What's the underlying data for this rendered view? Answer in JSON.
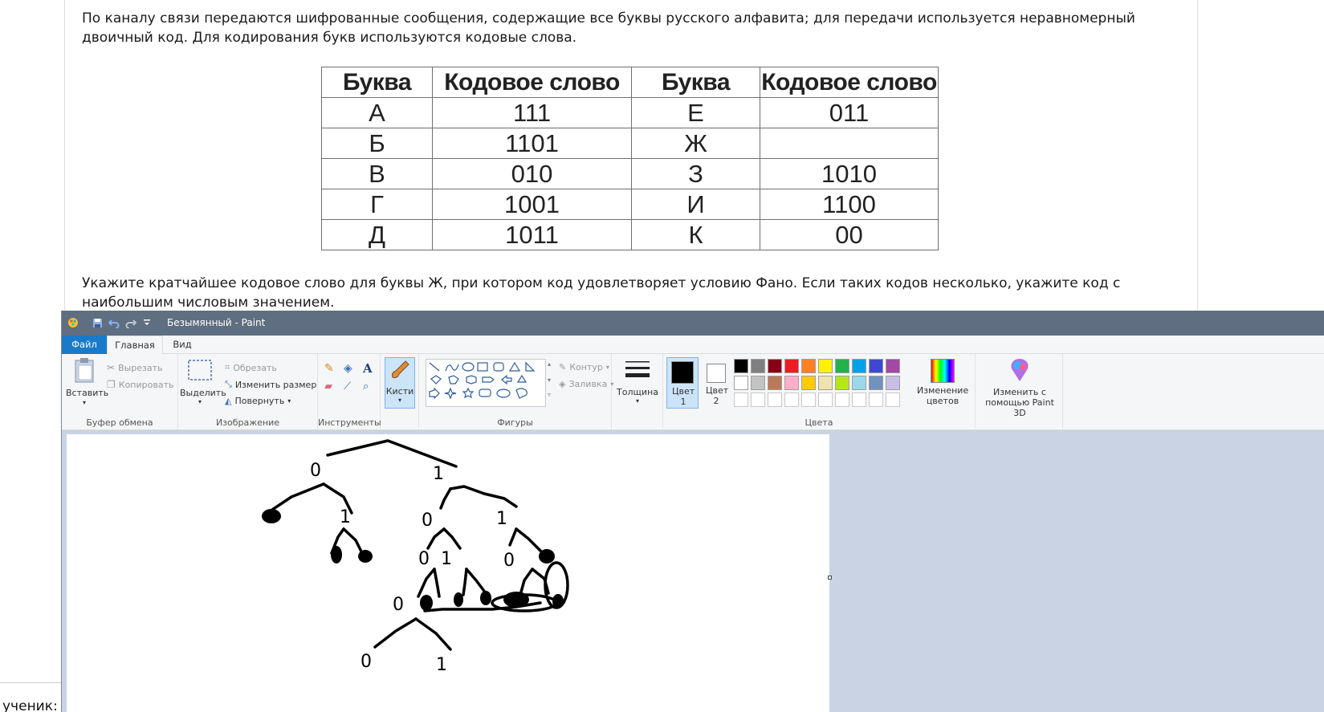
{
  "web": {
    "paragraph_1": "По каналу связи передаются шифрованные сообщения, содержащие все буквы русского алфавита; для передачи используется неравномерный двоичный код. Для кодирования букв используются кодовые слова.",
    "paragraph_2": "Укажите кратчайшее кодовое слово для буквы Ж, при котором код удовлетворяет условию Фано. Если таких кодов несколько, укажите код с наибольшим числовым значением.",
    "table": {
      "headers": [
        "Буква",
        "Кодовое слово",
        "Буква",
        "Кодовое слово"
      ],
      "rows": [
        [
          "А",
          "111",
          "Е",
          "011"
        ],
        [
          "Б",
          "1101",
          "Ж",
          ""
        ],
        [
          "В",
          "010",
          "З",
          "1010"
        ],
        [
          "Г",
          "1001",
          "И",
          "1100"
        ],
        [
          "Д",
          "1011",
          "К",
          "00"
        ]
      ]
    },
    "student_label": "ученик:"
  },
  "paint": {
    "title": "Безымянный - Paint",
    "tabs": [
      "Файл",
      "Главная",
      "Вид"
    ],
    "clipboard": {
      "paste": "Вставить",
      "cut": "Вырезать",
      "copy": "Копировать",
      "label": "Буфер обмена"
    },
    "image": {
      "select": "Выделить",
      "crop": "Обрезать",
      "resize": "Изменить размер",
      "rotate": "Повернуть",
      "label": "Изображение"
    },
    "tools": {
      "label": "Инструменты"
    },
    "brushes": {
      "label": "Кисти"
    },
    "shapes": {
      "outline": "Контур",
      "fill": "Заливка",
      "label": "Фигуры"
    },
    "size": {
      "label": "Толщина"
    },
    "colors": {
      "color1": "Цвет 1",
      "color2": "Цвет 2",
      "edit": "Изменение цветов",
      "paint3d": "Изменить с помощью Paint 3D",
      "label": "Цвета",
      "palette_row1": [
        "#000000",
        "#7f7f7f",
        "#880015",
        "#ed1c24",
        "#ff7f27",
        "#fff200",
        "#22b14c",
        "#00a2e8",
        "#3f48cc",
        "#a349a4"
      ],
      "palette_row2": [
        "#ffffff",
        "#c3c3c3",
        "#b97a57",
        "#ffaec9",
        "#ffc90e",
        "#efe4b0",
        "#b5e61d",
        "#99d9ea",
        "#7092be",
        "#c8bfe7"
      ],
      "palette_row3": [
        "#ffffff",
        "#ffffff",
        "#ffffff",
        "#ffffff",
        "#ffffff",
        "#ffffff",
        "#ffffff",
        "#ffffff",
        "#ffffff",
        "#ffffff"
      ]
    },
    "drawing": {
      "labels": [
        "0",
        "1",
        "0",
        "1",
        "0",
        "1",
        "0",
        "1",
        "0",
        "1",
        "0",
        "1"
      ]
    }
  }
}
